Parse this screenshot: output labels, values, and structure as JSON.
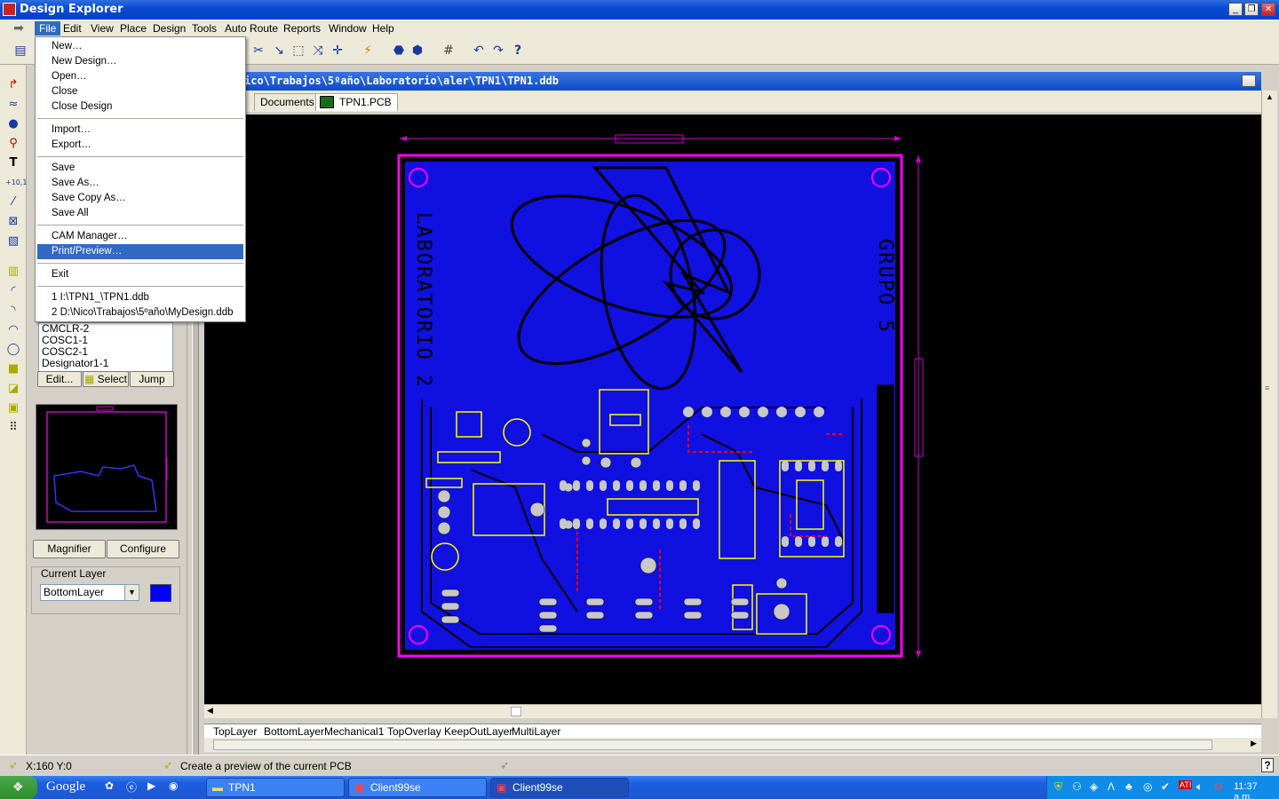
{
  "window": {
    "title": "Design Explorer"
  },
  "menubar": [
    "File",
    "Edit",
    "View",
    "Place",
    "Design",
    "Tools",
    "Auto Route",
    "Reports",
    "Window",
    "Help"
  ],
  "file_menu": {
    "items": [
      "New…",
      "New Design…",
      "Open…",
      "Close",
      "Close Design",
      "Import…",
      "Export…",
      "Save",
      "Save As…",
      "Save Copy As…",
      "Save All",
      "CAM Manager…",
      "Print/Preview…",
      "Exit",
      "1 I:\\TPN1_\\TPN1.ddb",
      "2 D:\\Nico\\Trabajos\\5ºaño\\MyDesign.ddb"
    ],
    "selected": "Print/Preview…"
  },
  "left_panel": {
    "list_items": [
      "CMCLR-2",
      "COSC1-1",
      "COSC2-1",
      "Designator1-1"
    ],
    "edit_label": "Edit...",
    "select_label": "Select",
    "jump_label": "Jump",
    "magnifier_label": "Magnifier",
    "configure_label": "Configure",
    "current_layer_label": "Current Layer",
    "current_layer_value": "BottomLayer",
    "current_layer_color": "#0000ff"
  },
  "document": {
    "path_title": "ico\\Trabajos\\5ºaño\\Laboratorio\\aler\\TPN1\\TPN1.ddb",
    "tabs": [
      "Documents",
      "TPN1.PCB"
    ],
    "selected_tab": "TPN1.PCB",
    "pcb_text_left": "LABORATORIO 2",
    "pcb_text_right": "GRUPO 5",
    "layer_tabs": [
      "TopLayer",
      "BottomLayer",
      "Mechanical1",
      "TopOverlay",
      "KeepOutLayer",
      "MultiLayer"
    ]
  },
  "status": {
    "coords": "X:160 Y:0",
    "message": "Create a preview of the current PCB"
  },
  "taskbar": {
    "search": "Google",
    "buttons": [
      "TPN1",
      "Client99se",
      "Client99se"
    ],
    "active_button": 2,
    "clock": "11:37 a.m."
  }
}
